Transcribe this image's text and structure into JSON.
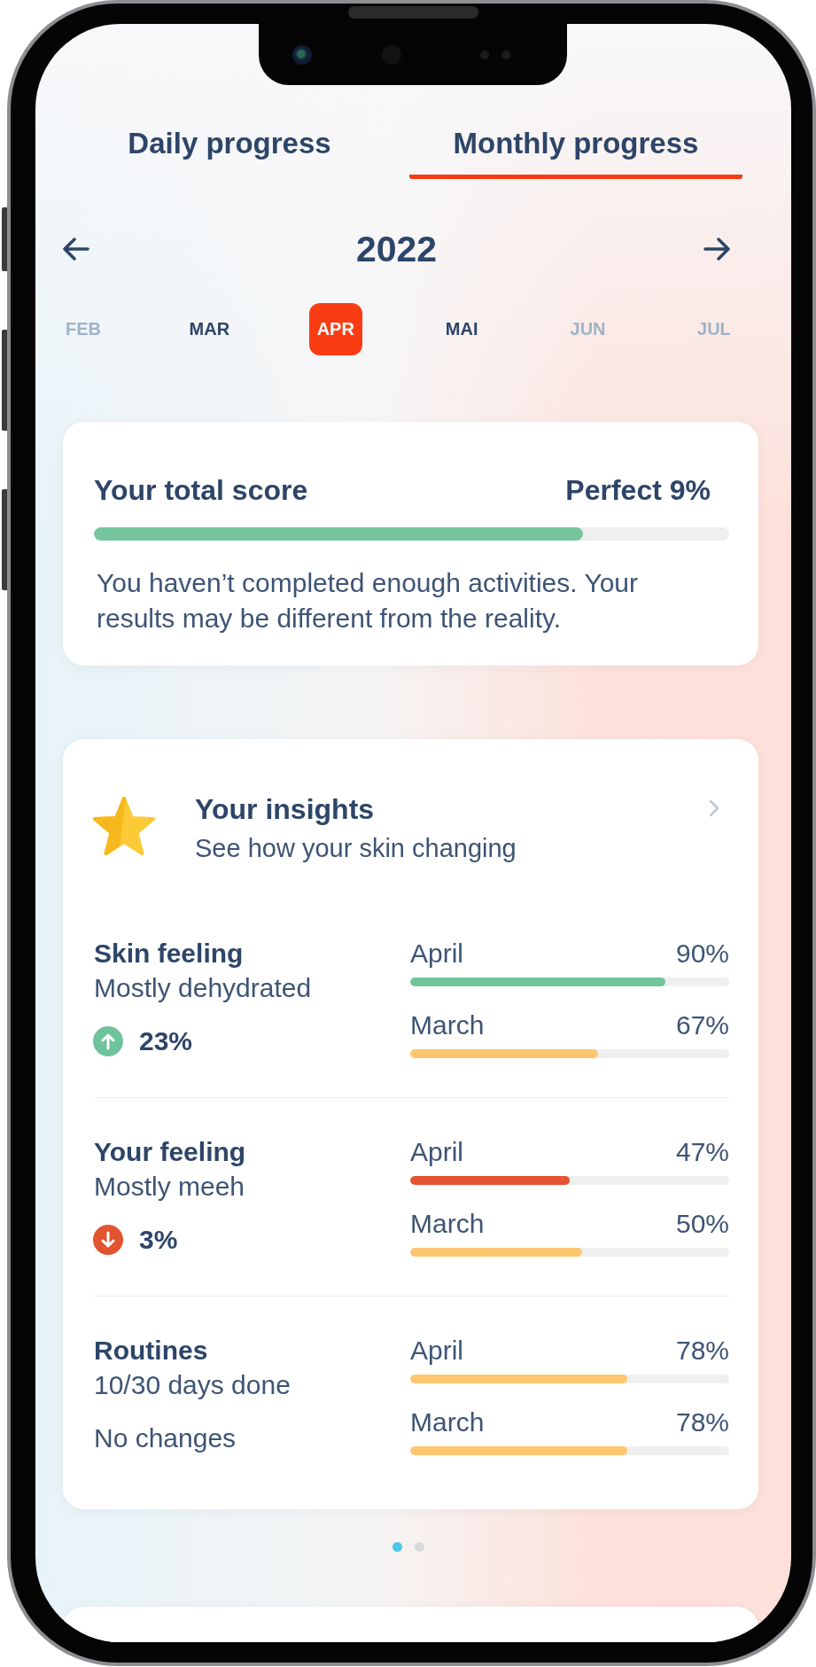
{
  "tabs": [
    {
      "label": "Daily progress",
      "selected": false
    },
    {
      "label": "Monthly progress",
      "selected": true
    }
  ],
  "year": "2022",
  "months": [
    {
      "label": "FEB",
      "selected": false,
      "faded": true
    },
    {
      "label": "MAR",
      "selected": false,
      "faded": false
    },
    {
      "label": "APR",
      "selected": true,
      "faded": false
    },
    {
      "label": "MAI",
      "selected": false,
      "faded": false
    },
    {
      "label": "JUN",
      "selected": false,
      "faded": true
    },
    {
      "label": "JUL",
      "selected": false,
      "faded": true
    }
  ],
  "score_card": {
    "title": "Your total score",
    "value": "Perfect 9%",
    "level": 0.77,
    "note": "You haven’t completed enough activities. Your results may be different from the reality."
  },
  "insights": {
    "title": "Your insights",
    "subtitle": "See how your skin changing",
    "rows": [
      {
        "title": "Skin feeling",
        "subtitle": "Mostly dehydrated",
        "kind": "increase",
        "change": "23%",
        "bars": [
          {
            "label": "April",
            "value": "90%",
            "level": 0.8,
            "color": "#72c49c"
          },
          {
            "label": "March",
            "value": "67%",
            "level": 0.59,
            "color": "#fdc66f"
          }
        ]
      },
      {
        "title": "Your feeling",
        "subtitle": "Mostly meeh",
        "kind": "decrease",
        "change": "3%",
        "bars": [
          {
            "label": "April",
            "value": "47%",
            "level": 0.5,
            "color": "#e5532f"
          },
          {
            "label": "March",
            "value": "50%",
            "level": 0.54,
            "color": "#fdc66f"
          }
        ]
      },
      {
        "title": "Routines",
        "subtitle": "10/30 days done",
        "kind": "unchanged",
        "change": "No changes",
        "bars": [
          {
            "label": "April",
            "value": "78%",
            "level": 0.68,
            "color": "#fdc66f"
          },
          {
            "label": "March",
            "value": "78%",
            "level": 0.68,
            "color": "#fdc66f"
          }
        ]
      }
    ]
  },
  "pager": [
    {
      "selected": true
    },
    {
      "selected": false
    }
  ]
}
